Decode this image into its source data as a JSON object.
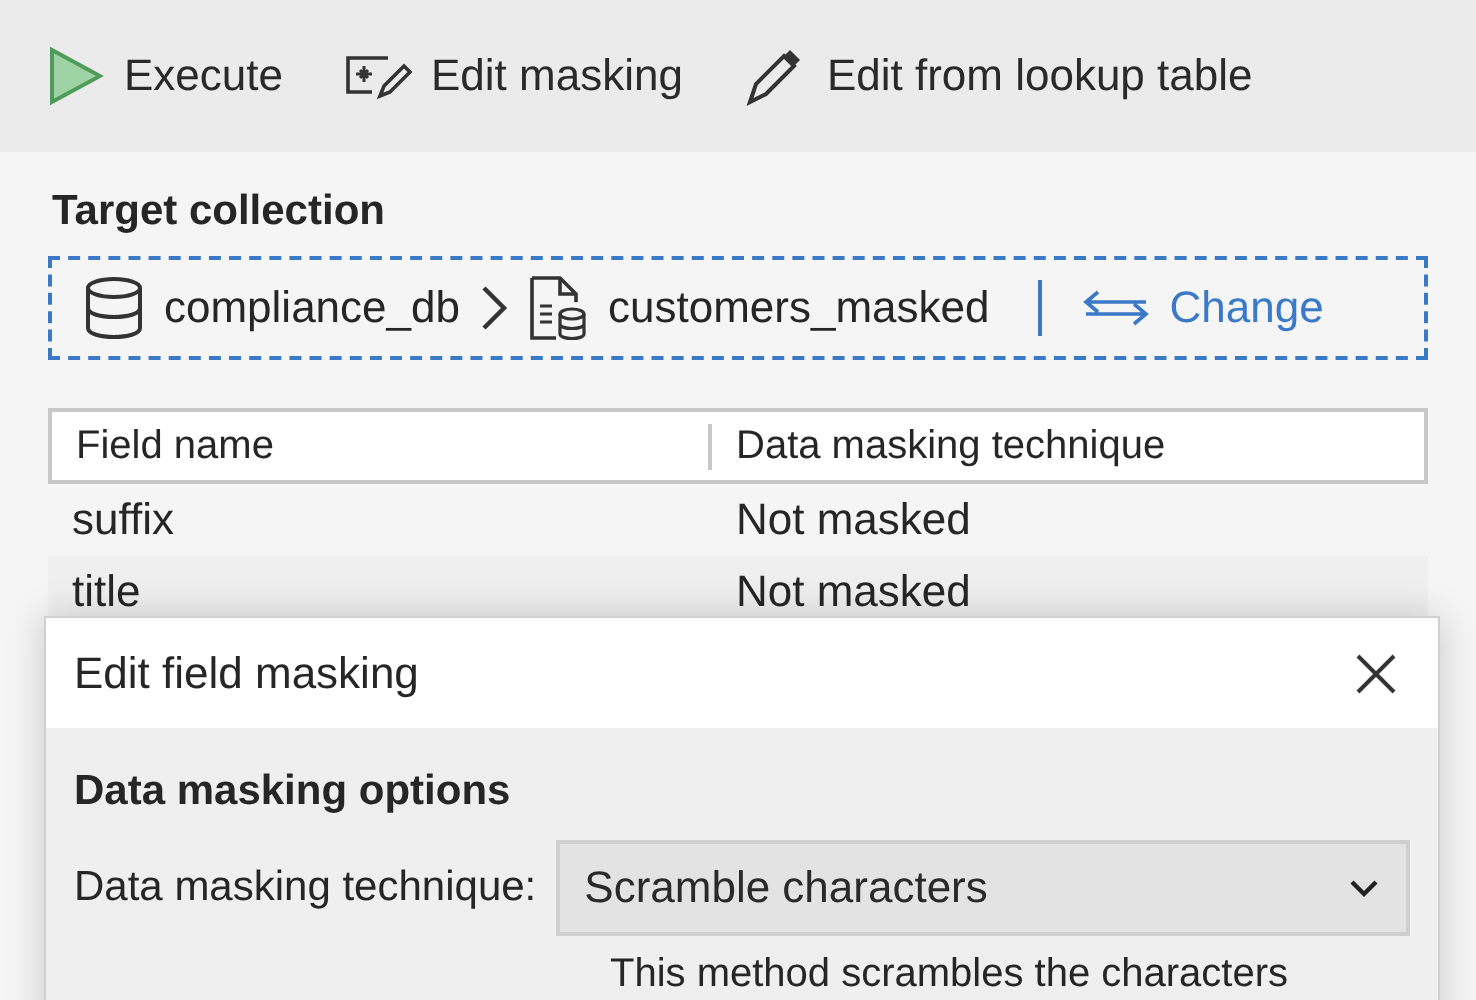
{
  "toolbar": [
    {
      "kind": "play",
      "label": "Execute"
    },
    {
      "kind": "mask",
      "label": "Edit masking"
    },
    {
      "kind": "pen",
      "label": "Edit from lookup table"
    }
  ],
  "target": {
    "heading": "Target collection",
    "database": "compliance_db",
    "collection": "customers_masked",
    "action": "Change"
  },
  "table": {
    "columns": [
      "Field name",
      "Data masking technique"
    ],
    "rows": [
      {
        "cells": [
          "suffix",
          "Not masked"
        ]
      },
      {
        "cells": [
          "title",
          "Not masked"
        ]
      }
    ]
  },
  "dialog": {
    "title": "Edit field masking",
    "section": "Data masking options",
    "field_label": "Data masking technique:",
    "value": "Scramble characters",
    "description": "This method scrambles the characters"
  }
}
